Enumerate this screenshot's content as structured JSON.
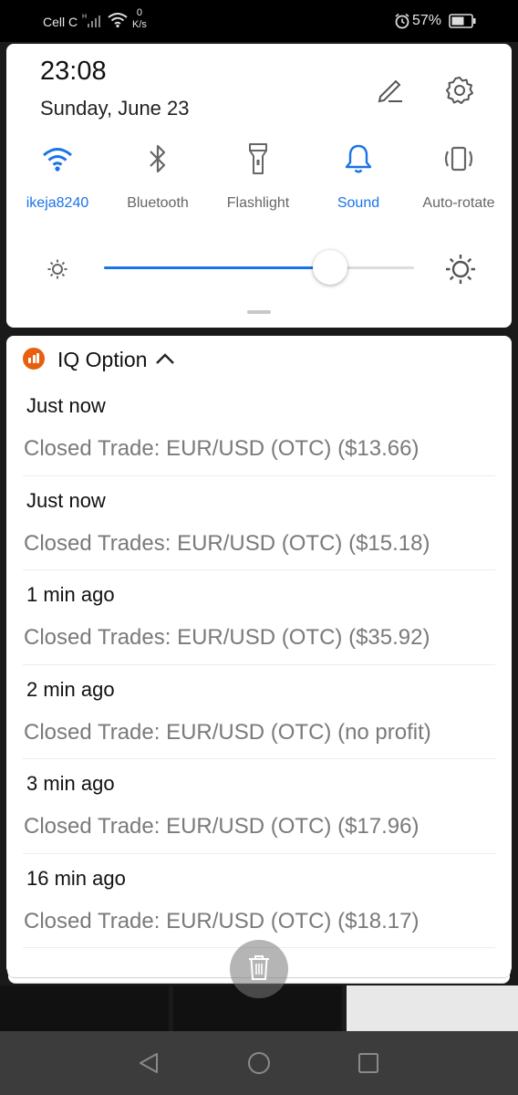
{
  "status_bar": {
    "carrier": "Cell C",
    "network_speed_value": "0",
    "network_speed_unit": "K/s",
    "battery_percent": "57%",
    "icons": [
      "signal-icon",
      "wifi-icon",
      "alarm-icon",
      "battery-icon"
    ]
  },
  "quick_settings": {
    "time": "23:08",
    "date": "Sunday, June 23",
    "tiles": [
      {
        "label": "ikeja8240",
        "icon": "wifi-icon",
        "active": true
      },
      {
        "label": "Bluetooth",
        "icon": "bluetooth-icon",
        "active": false
      },
      {
        "label": "Flashlight",
        "icon": "flashlight-icon",
        "active": false
      },
      {
        "label": "Sound",
        "icon": "bell-icon",
        "active": true
      },
      {
        "label": "Auto-rotate",
        "icon": "auto-rotate-icon",
        "active": false
      }
    ],
    "brightness_level": 0.73
  },
  "notification_group": {
    "app_name": "IQ Option",
    "icon": "iq-option-app-icon",
    "accent_color": "#e8600f",
    "items": [
      {
        "time": "Just now",
        "text": "Closed Trade: EUR/USD (OTC) ($13.66)"
      },
      {
        "time": "Just now",
        "text": "Closed Trades: EUR/USD (OTC) ($15.18)"
      },
      {
        "time": "1 min ago",
        "text": "Closed Trades: EUR/USD (OTC) ($35.92)"
      },
      {
        "time": "2 min ago",
        "text": "Closed Trade: EUR/USD (OTC) (no profit)"
      },
      {
        "time": "3 min ago",
        "text": "Closed Trade: EUR/USD (OTC) ($17.96)"
      },
      {
        "time": "16 min ago",
        "text": "Closed Trade: EUR/USD (OTC) ($18.17)"
      }
    ]
  },
  "colors": {
    "accent_blue": "#1a73e8"
  }
}
